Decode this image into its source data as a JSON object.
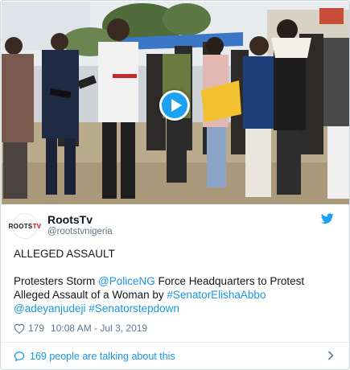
{
  "author": {
    "display_name": "RootsTv",
    "handle": "@rootstvnigeria",
    "avatar_text_a": "ROOTS",
    "avatar_text_b": "TV"
  },
  "tweet": {
    "line1": "ALLEGED ASSAULT",
    "body_prefix": "Protesters Storm ",
    "mention_police": "@PoliceNG",
    "body_mid": " Force Headquarters to Protest Alleged Assault of a Woman by ",
    "hashtag_senator": "#SenatorElishaAbbo",
    "mention_user": "@adeyanjudeji",
    "hashtag_stepdown": "#Senatorstepdown"
  },
  "meta": {
    "likes": "179",
    "timestamp": "10:08 AM - Jul 3, 2019"
  },
  "footer": {
    "conversation_label": "169 people are talking about this"
  },
  "colors": {
    "accent": "#1da1f2",
    "link": "#1b95e0",
    "muted": "#657786"
  },
  "icons": [
    "play-icon",
    "twitter-bird-icon",
    "heart-icon",
    "reply-icon",
    "chevron-right-icon"
  ]
}
